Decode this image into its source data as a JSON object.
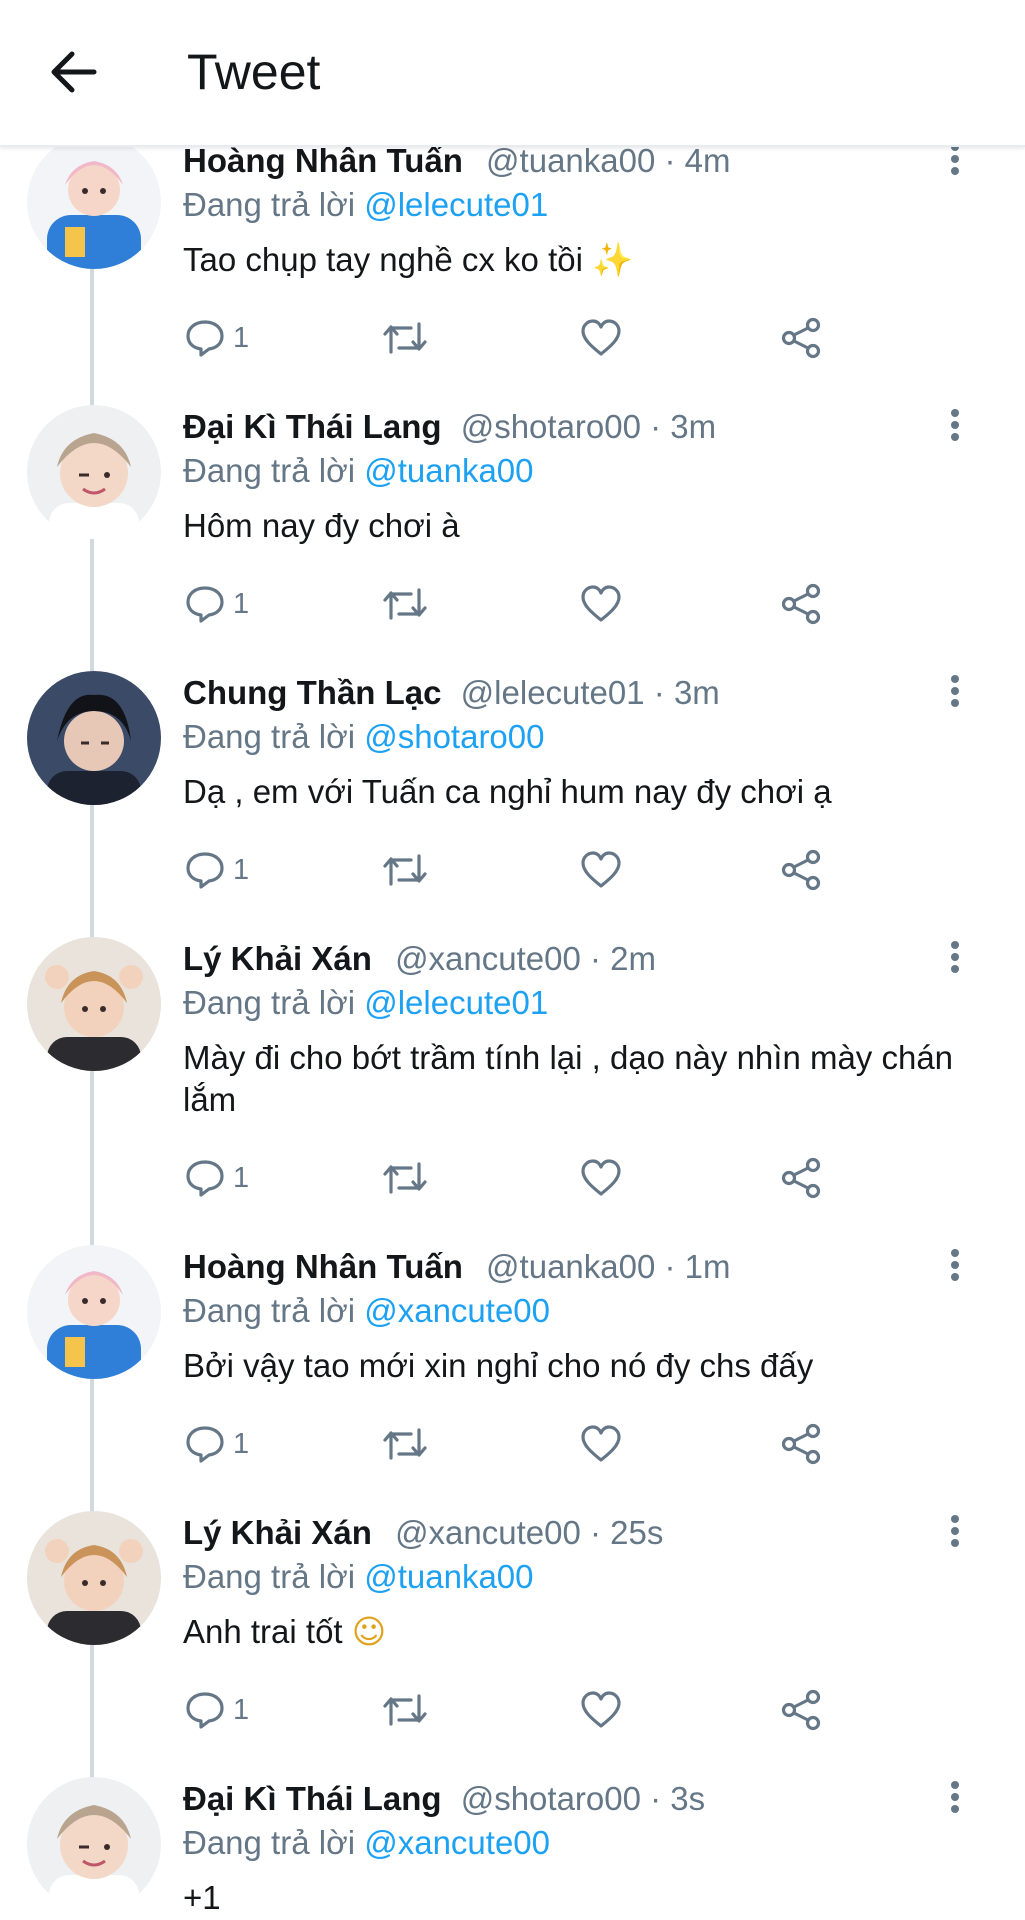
{
  "header": {
    "title": "Tweet",
    "back_icon": "arrow-left-icon"
  },
  "colors": {
    "link": "#1da1f2",
    "secondary_text": "#657786",
    "icon": "#657786",
    "thread_line": "#cfd9de"
  },
  "tweets": [
    {
      "name": "Hoàng Nhân Tuấn",
      "meta": "@tuanka00 · 4m",
      "reply_prefix": "Đang trả lời",
      "reply_to": "@lelecute01",
      "text": "Tao chụp tay nghề cx ko tồi",
      "emoji": "✨",
      "reply_count": "1"
    },
    {
      "name": "Đại Kì Thái Lang",
      "meta": "@shotaro00 · 3m",
      "reply_prefix": "Đang trả lời",
      "reply_to": "@tuanka00",
      "text": "Hôm nay đy chơi à",
      "emoji": "",
      "reply_count": "1"
    },
    {
      "name": "Chung Thần Lạc",
      "meta": "@lelecute01 · 3m",
      "reply_prefix": "Đang trả lời",
      "reply_to": "@shotaro00",
      "text": "Dạ , em với Tuấn ca nghỉ hum nay đy chơi ạ",
      "emoji": "",
      "reply_count": "1"
    },
    {
      "name": "Lý Khải Xán",
      "meta": "@xancute00 · 2m",
      "reply_prefix": "Đang trả lời",
      "reply_to": "@lelecute01",
      "text": "Mày đi cho bớt trầm tính lại , dạo này nhìn mày chán lắm",
      "emoji": "",
      "reply_count": "1"
    },
    {
      "name": "Hoàng Nhân Tuấn",
      "meta": "@tuanka00 · 1m",
      "reply_prefix": "Đang trả lời",
      "reply_to": "@xancute00",
      "text": "Bởi vậy tao mới xin nghỉ cho nó đy chs đấy",
      "emoji": "",
      "reply_count": "1"
    },
    {
      "name": "Lý Khải Xán",
      "meta": "@xancute00 · 25s",
      "reply_prefix": "Đang trả lời",
      "reply_to": "@tuanka00",
      "text": "Anh trai tốt",
      "emoji": "☺",
      "reply_count": "1"
    },
    {
      "name": "Đại Kì Thái Lang",
      "meta": "@shotaro00 · 3s",
      "reply_prefix": "Đang trả lời",
      "reply_to": "@xancute00",
      "text": "+1",
      "emoji": "",
      "reply_count": ""
    }
  ],
  "action_icons": [
    "reply-icon",
    "retweet-icon",
    "like-icon",
    "share-icon"
  ]
}
